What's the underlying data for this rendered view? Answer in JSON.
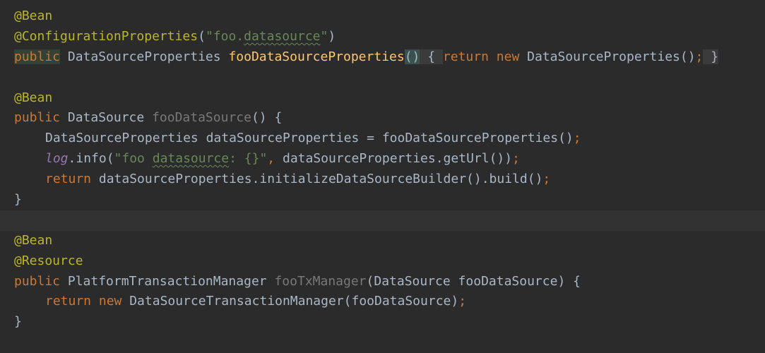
{
  "editor": {
    "colors": {
      "background": "#2b2b2b",
      "current_line": "#323232",
      "annotation": "#bbb529",
      "keyword": "#cc7832",
      "string": "#6a8759",
      "method_declaration": "#ffc66d",
      "unused_method": "#787878",
      "instance_field": "#9876aa",
      "identifier": "#a9b7c6"
    },
    "current_line_index": 10,
    "lines": [
      {
        "tokens": [
          {
            "t": "@Bean",
            "c": "annotation"
          }
        ]
      },
      {
        "tokens": [
          {
            "t": "@ConfigurationProperties",
            "c": "annotation"
          },
          {
            "t": "(",
            "c": "plain"
          },
          {
            "t": "\"foo.",
            "c": "string"
          },
          {
            "t": "datasource",
            "c": "string typo"
          },
          {
            "t": "\"",
            "c": "string"
          },
          {
            "t": ")",
            "c": "plain"
          }
        ]
      },
      {
        "tokens": [
          {
            "t": "public",
            "c": "keyword kw-highlight"
          },
          {
            "t": " DataSourceProperties ",
            "c": "plain"
          },
          {
            "t": "fooDataSourceProperties",
            "c": "method-decl"
          },
          {
            "t": "()",
            "c": "plain brace-hl"
          },
          {
            "t": " { ",
            "c": "fold"
          },
          {
            "t": "return new ",
            "c": "keyword"
          },
          {
            "t": "DataSourceProperties()",
            "c": "plain"
          },
          {
            "t": ";",
            "c": "keyword"
          },
          {
            "t": " }",
            "c": "fold"
          }
        ]
      },
      {
        "tokens": []
      },
      {
        "tokens": [
          {
            "t": "@Bean",
            "c": "annotation"
          }
        ]
      },
      {
        "tokens": [
          {
            "t": "public ",
            "c": "keyword"
          },
          {
            "t": "DataSource ",
            "c": "plain"
          },
          {
            "t": "fooDataSource",
            "c": "method-unused"
          },
          {
            "t": "() {",
            "c": "plain"
          }
        ]
      },
      {
        "indent": 1,
        "tokens": [
          {
            "t": "DataSourceProperties dataSourceProperties = fooDataSourceProperties()",
            "c": "plain"
          },
          {
            "t": ";",
            "c": "keyword"
          }
        ]
      },
      {
        "indent": 1,
        "tokens": [
          {
            "t": "log",
            "c": "field"
          },
          {
            "t": ".info(",
            "c": "plain"
          },
          {
            "t": "\"foo ",
            "c": "string"
          },
          {
            "t": "datasource",
            "c": "string typo"
          },
          {
            "t": ": {}\"",
            "c": "string"
          },
          {
            "t": ", ",
            "c": "keyword"
          },
          {
            "t": "dataSourceProperties.getUrl())",
            "c": "plain"
          },
          {
            "t": ";",
            "c": "keyword"
          }
        ]
      },
      {
        "indent": 1,
        "tokens": [
          {
            "t": "return ",
            "c": "keyword"
          },
          {
            "t": "dataSourceProperties.initializeDataSourceBuilder().build()",
            "c": "plain"
          },
          {
            "t": ";",
            "c": "keyword"
          }
        ]
      },
      {
        "tokens": [
          {
            "t": "}",
            "c": "plain"
          }
        ]
      },
      {
        "tokens": []
      },
      {
        "tokens": [
          {
            "t": "@Bean",
            "c": "annotation"
          }
        ]
      },
      {
        "tokens": [
          {
            "t": "@Resource",
            "c": "annotation"
          }
        ]
      },
      {
        "tokens": [
          {
            "t": "public ",
            "c": "keyword"
          },
          {
            "t": "PlatformTransactionManager ",
            "c": "plain"
          },
          {
            "t": "fooTxManager",
            "c": "method-unused"
          },
          {
            "t": "(DataSource fooDataSource) {",
            "c": "plain"
          }
        ]
      },
      {
        "indent": 1,
        "tokens": [
          {
            "t": "return new ",
            "c": "keyword"
          },
          {
            "t": "DataSourceTransactionManager(fooDataSource)",
            "c": "plain"
          },
          {
            "t": ";",
            "c": "keyword"
          }
        ]
      },
      {
        "tokens": [
          {
            "t": "}",
            "c": "plain"
          }
        ]
      },
      {
        "tokens": []
      }
    ]
  }
}
